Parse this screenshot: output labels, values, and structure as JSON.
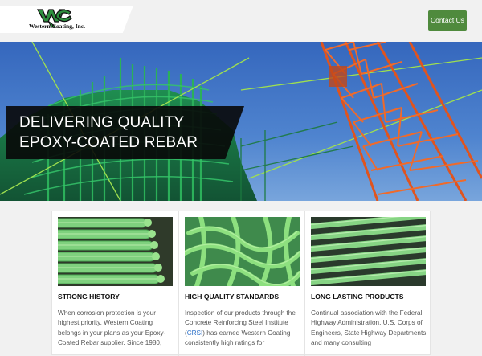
{
  "header": {
    "logo_text": "Western Coating, Inc.",
    "contact_label": "Contact Us"
  },
  "hero": {
    "line1": "DELIVERING QUALITY",
    "line2": "EPOXY-COATED REBAR"
  },
  "cards": [
    {
      "title": "STRONG HISTORY",
      "body": "When corrosion protection is your highest priority, Western Coating belongs in your plans as your Epoxy-Coated Rebar supplier. Since 1980,"
    },
    {
      "title": "HIGH QUALITY STANDARDS",
      "body_before": "Inspection of our products through the Concrete Reinforcing Steel Institute (",
      "link": "CRSI",
      "body_after": ") has earned Western Coating consistently high ratings for"
    },
    {
      "title": "LONG LASTING PRODUCTS",
      "body": "Continual association with the Federal Highway Administration, U.S. Corps of Engineers, State Highway Departments and many consulting"
    }
  ],
  "colors": {
    "accent_green": "#4f8a3d",
    "link_blue": "#2a6fc9",
    "banner_black": "#080808"
  }
}
